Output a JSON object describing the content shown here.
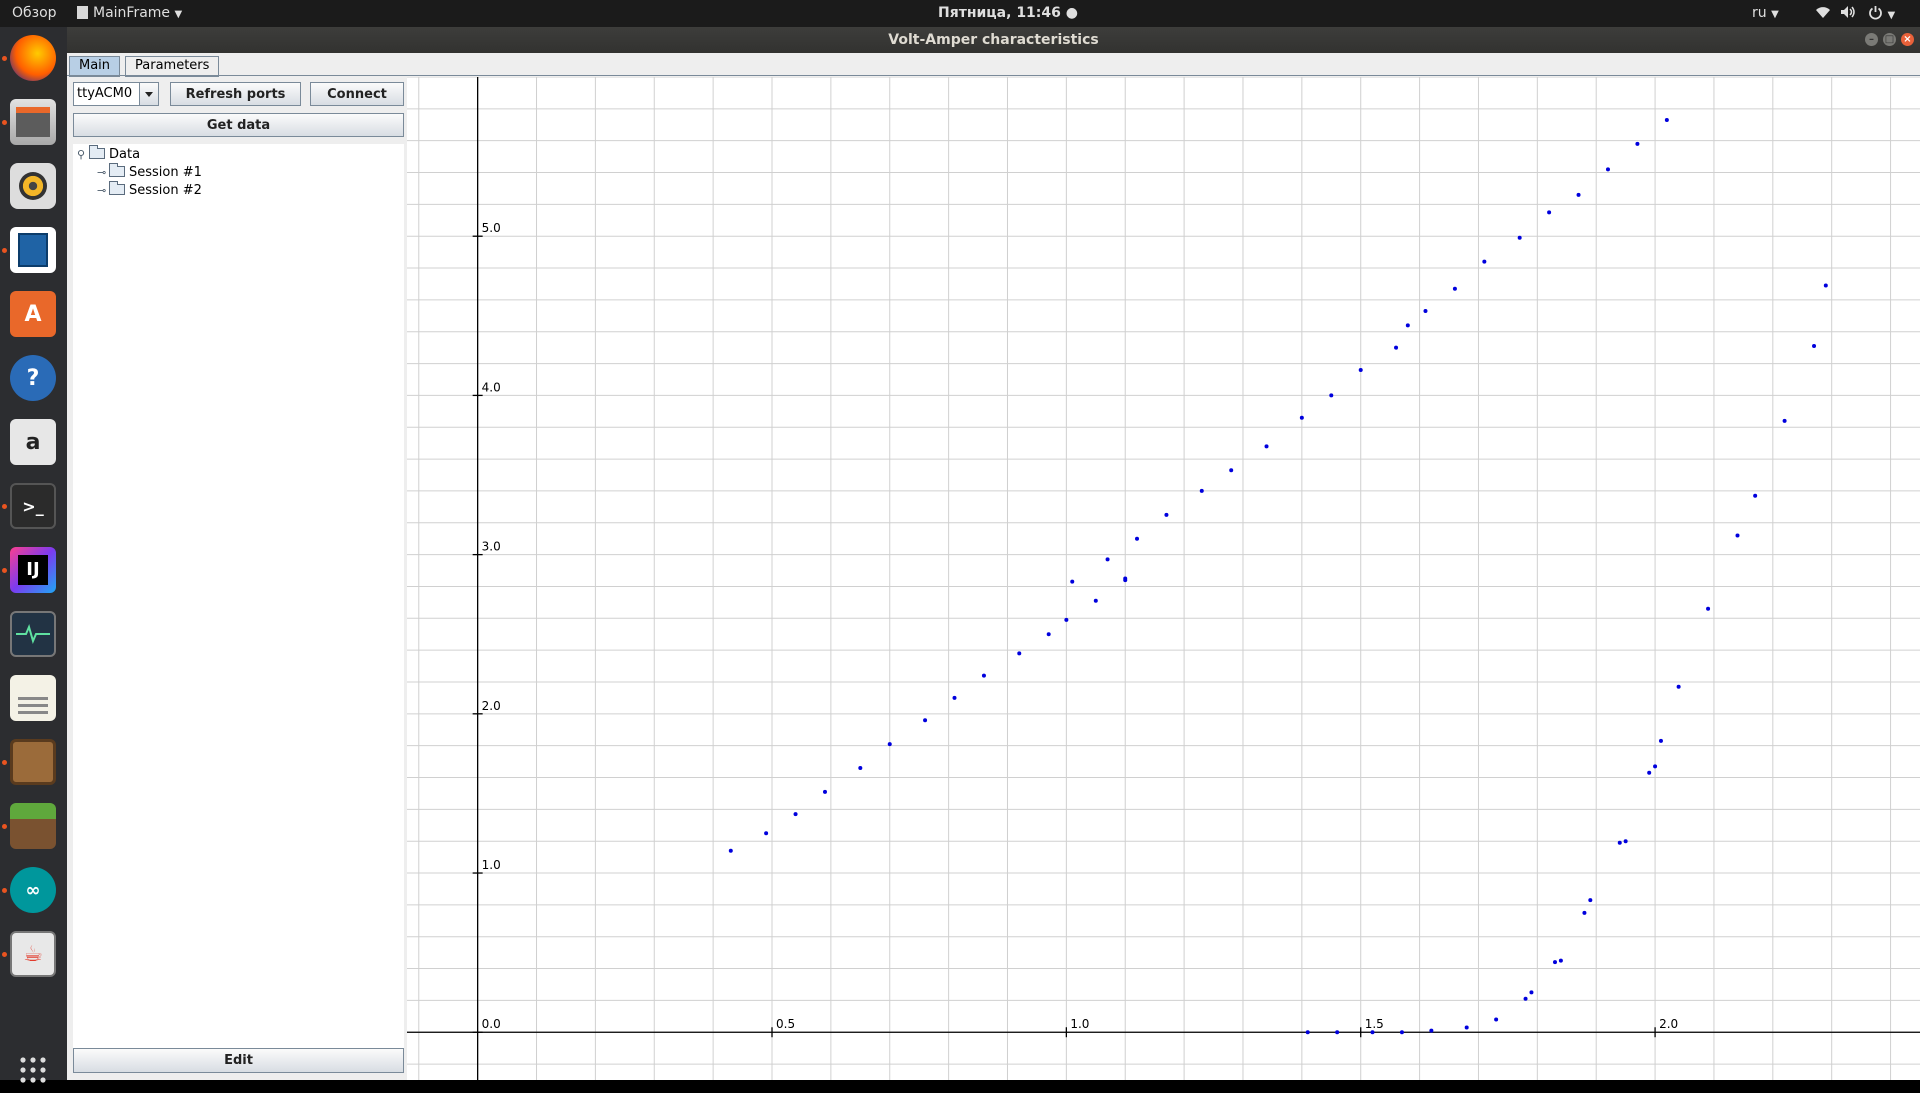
{
  "topbar": {
    "activities": "Обзор",
    "app_menu": "MainFrame",
    "clock": "Пятница, 11:46 ●",
    "lang": "ru"
  },
  "window": {
    "title": "Volt-Amper characteristics"
  },
  "tabs": [
    {
      "label": "Main",
      "active": true
    },
    {
      "label": "Parameters",
      "active": false
    }
  ],
  "controls": {
    "port_value": "ttyACM0",
    "refresh_label": "Refresh ports",
    "connect_label": "Connect",
    "get_data_label": "Get data",
    "edit_label": "Edit"
  },
  "tree": {
    "root": "Data",
    "children": [
      "Session #1",
      "Session #2"
    ]
  },
  "launcher": {
    "icons": [
      "firefox-icon",
      "files-icon",
      "rhythmbox-icon",
      "writer-icon",
      "software-center-icon",
      "help-icon",
      "amazon-icon",
      "terminal-icon",
      "intellij-icon",
      "system-monitor-icon",
      "text-editor-icon",
      "crafting-table-icon",
      "minecraft-icon",
      "arduino-icon",
      "java-icon",
      "app-grid-icon"
    ]
  },
  "colors": {
    "point": "#0000dd",
    "grid": "#d0d0d0",
    "accent": "#e95420"
  },
  "chart_data": {
    "type": "scatter",
    "title": "",
    "xlabel": "",
    "ylabel": "",
    "xlim": [
      -0.12,
      2.45
    ],
    "ylim": [
      -0.3,
      6.0
    ],
    "grid": true,
    "x_ticks": [
      "0.5",
      "1.0",
      "1.5",
      "2.0"
    ],
    "x_tick_values": [
      0.5,
      1.0,
      1.5,
      2.0
    ],
    "y_ticks": [
      "0.0",
      "1.0",
      "2.0",
      "3.0",
      "4.0",
      "5.0"
    ],
    "y_tick_values": [
      0.0,
      1.0,
      2.0,
      3.0,
      4.0,
      5.0
    ],
    "series": [
      {
        "points": [
          [
            0.43,
            1.14
          ],
          [
            0.49,
            1.25
          ],
          [
            0.54,
            1.37
          ],
          [
            0.59,
            1.51
          ],
          [
            0.65,
            1.66
          ],
          [
            0.7,
            1.81
          ],
          [
            0.76,
            1.96
          ],
          [
            0.81,
            2.1
          ],
          [
            0.86,
            2.24
          ],
          [
            0.92,
            2.38
          ],
          [
            0.97,
            2.5
          ],
          [
            1.0,
            2.59
          ],
          [
            1.01,
            2.83
          ],
          [
            1.05,
            2.71
          ],
          [
            1.07,
            2.97
          ],
          [
            1.1,
            2.84
          ],
          [
            1.1,
            2.85
          ],
          [
            1.12,
            3.1
          ],
          [
            1.17,
            3.25
          ],
          [
            1.23,
            3.4
          ],
          [
            1.28,
            3.53
          ],
          [
            1.34,
            3.68
          ],
          [
            1.4,
            3.86
          ],
          [
            1.45,
            4.0
          ],
          [
            1.5,
            4.16
          ],
          [
            1.56,
            4.3
          ],
          [
            1.58,
            4.44
          ],
          [
            1.61,
            4.53
          ],
          [
            1.66,
            4.67
          ],
          [
            1.71,
            4.84
          ],
          [
            1.77,
            4.99
          ],
          [
            1.82,
            5.15
          ],
          [
            1.87,
            5.26
          ],
          [
            1.92,
            5.42
          ],
          [
            1.97,
            5.58
          ],
          [
            2.02,
            5.73
          ]
        ]
      },
      {
        "points": [
          [
            1.41,
            0.0
          ],
          [
            1.46,
            0.0
          ],
          [
            1.52,
            0.0
          ],
          [
            1.57,
            0.0
          ],
          [
            1.62,
            0.01
          ],
          [
            1.68,
            0.03
          ],
          [
            1.73,
            0.08
          ],
          [
            1.78,
            0.21
          ],
          [
            1.79,
            0.25
          ],
          [
            1.83,
            0.44
          ],
          [
            1.84,
            0.45
          ],
          [
            1.88,
            0.75
          ],
          [
            1.89,
            0.83
          ],
          [
            1.94,
            1.19
          ],
          [
            1.95,
            1.2
          ],
          [
            1.99,
            1.63
          ],
          [
            2.0,
            1.67
          ],
          [
            2.01,
            1.83
          ],
          [
            2.04,
            2.17
          ],
          [
            2.09,
            2.66
          ],
          [
            2.14,
            3.12
          ],
          [
            2.17,
            3.37
          ],
          [
            2.22,
            3.84
          ],
          [
            2.27,
            4.31
          ],
          [
            2.29,
            4.69
          ]
        ]
      }
    ]
  }
}
